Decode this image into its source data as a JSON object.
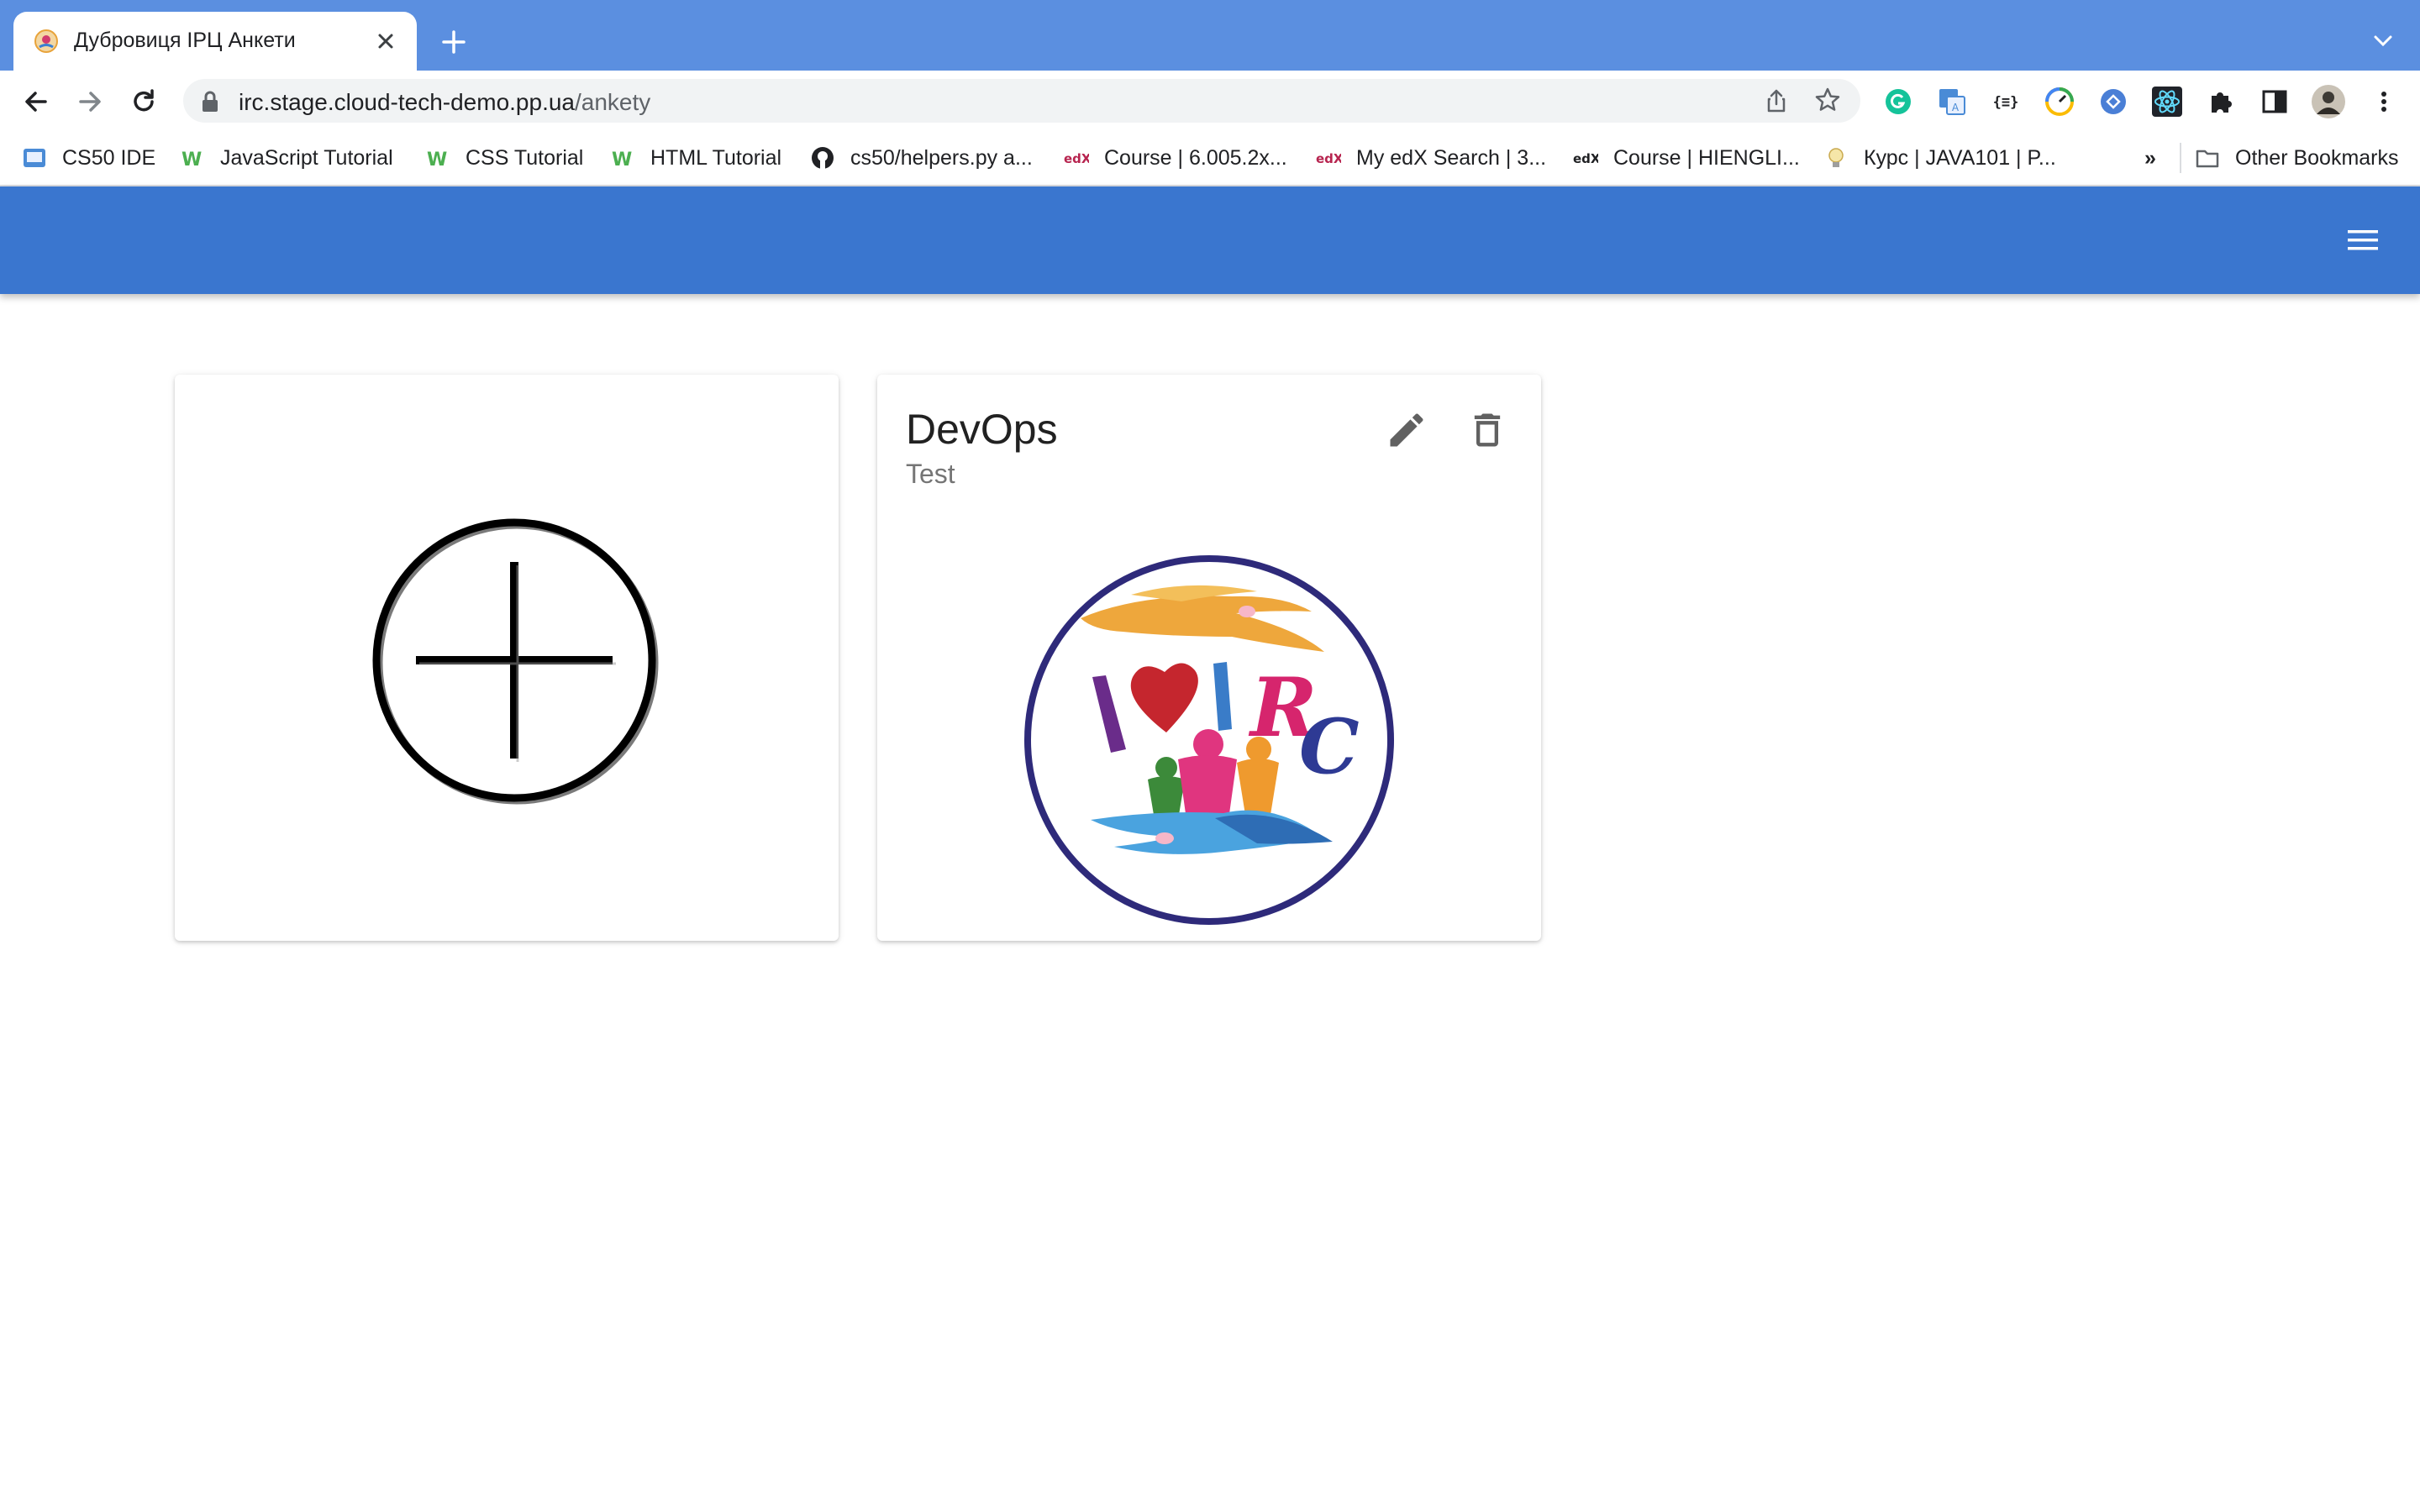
{
  "browser": {
    "tab": {
      "title": "Дубровиця ІРЦ Анкети",
      "favicon": "irc-logo-icon"
    },
    "toolbar": {
      "url_host": "irc.stage.cloud-tech-demo.pp.ua",
      "url_path": "/ankety",
      "extensions": [
        "grammarly-icon",
        "translate-icon",
        "json-icon",
        "pagespeed-icon",
        "react-devtools-icon",
        "react-icon",
        "puzzle-icon",
        "sidebar-icon",
        "profile-avatar",
        "more-icon"
      ]
    },
    "bookmarks": [
      {
        "label": "CS50 IDE",
        "icon": "cs50-icon"
      },
      {
        "label": "JavaScript Tutorial",
        "icon": "w3schools-icon"
      },
      {
        "label": "CSS Tutorial",
        "icon": "w3schools-icon"
      },
      {
        "label": "HTML Tutorial",
        "icon": "w3schools-icon"
      },
      {
        "label": "cs50/helpers.py a...",
        "icon": "github-icon"
      },
      {
        "label": "Course | 6.005.2x...",
        "icon": "edx-icon"
      },
      {
        "label": "My edX Search | 3...",
        "icon": "edx-icon"
      },
      {
        "label": "Course | HIENGLI...",
        "icon": "edx-icon"
      },
      {
        "label": "Курс | JAVA101 | P...",
        "icon": "lightbulb-icon"
      }
    ],
    "overflow_label": "»",
    "other_bookmarks": "Other Bookmarks"
  },
  "app": {
    "accent_color": "#3a76cf",
    "cards": [
      {
        "type": "add",
        "icon": "add-circle-icon"
      },
      {
        "type": "survey",
        "title": "DevOps",
        "subtitle": "Test",
        "logo_letters": "IRC"
      }
    ]
  }
}
